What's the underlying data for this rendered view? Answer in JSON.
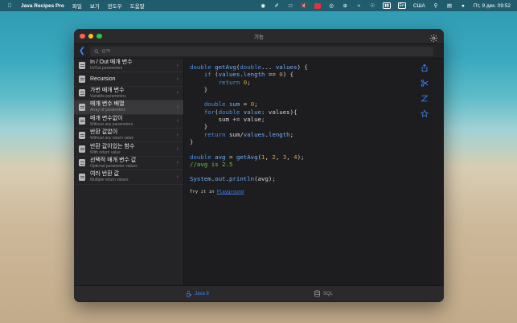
{
  "menubar": {
    "app_name": "Java Recipes Pro",
    "menus": [
      "파일",
      "보기",
      "윈도우",
      "도움말"
    ],
    "input_source": "США",
    "datetime": "Пт, 9 дек.  09:52"
  },
  "window": {
    "title": "기능"
  },
  "search": {
    "placeholder": "검색"
  },
  "sidebar": {
    "items": [
      {
        "title": "In / Out 매개 변수",
        "subtitle": "In/Out parameters"
      },
      {
        "title": "Recursion",
        "subtitle": ""
      },
      {
        "title": "가변 매개 변수",
        "subtitle": "Variable parameters"
      },
      {
        "title": "매개 변수 배열",
        "subtitle": "Array of parameters"
      },
      {
        "title": "매개 변수없이",
        "subtitle": "Without any parameters"
      },
      {
        "title": "반환 값없이",
        "subtitle": "Without any return value"
      },
      {
        "title": "반환 값이있는 함수",
        "subtitle": "With return value"
      },
      {
        "title": "선택적 매개 변수 값",
        "subtitle": "Optional parameter values"
      },
      {
        "title": "여러 반환 값",
        "subtitle": "Multiple return values"
      }
    ],
    "selected_index": 3
  },
  "content": {
    "try_prefix": "Try it in ",
    "try_link": "Playground"
  },
  "tabs": {
    "java": "Java 8",
    "sql": "SQL"
  },
  "colors": {
    "accent": "#3b82f6",
    "keyword": "#4a90e2",
    "number": "#c9a443",
    "comment": "#6cc24a"
  }
}
